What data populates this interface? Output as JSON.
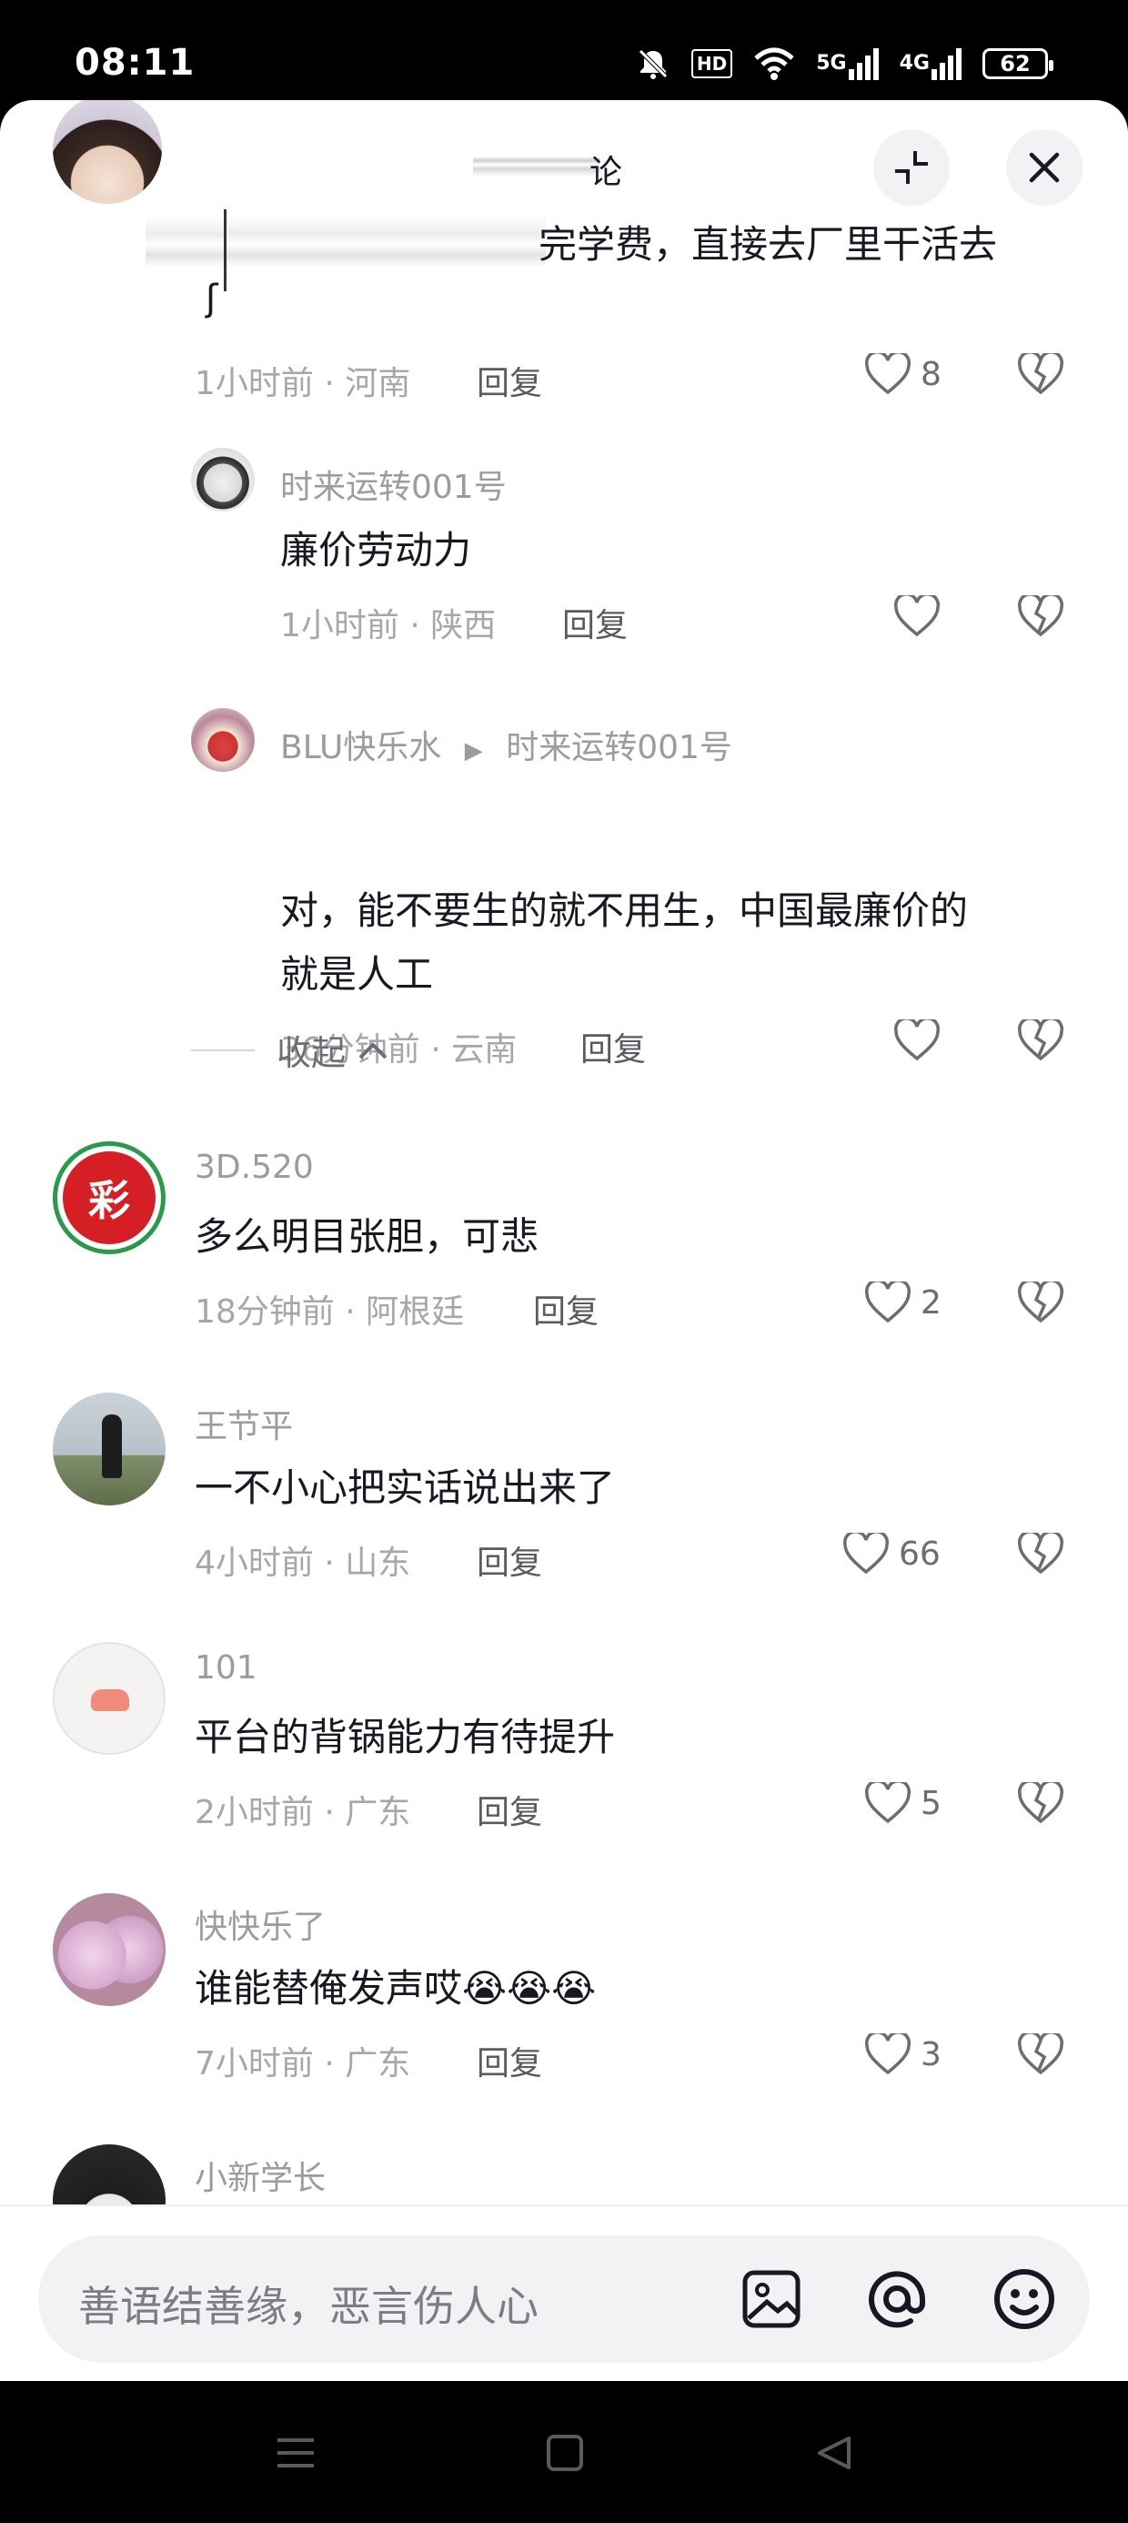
{
  "status_bar": {
    "time": "08:11",
    "battery": "62",
    "net1": "5G",
    "net2": "4G",
    "hd": "HD"
  },
  "header": {
    "title_fragment": "论",
    "icons": [
      "collapse-icon",
      "close-icon"
    ]
  },
  "first_comment": {
    "text_visible": "完学费，直接去厂里干活去",
    "time_location": "1小时前 · 河南",
    "reply_label": "回复",
    "likes": "8"
  },
  "replies": [
    {
      "name": "时来运转001号",
      "text": "廉价劳动力",
      "time_location": "1小时前 · 陕西",
      "reply_label": "回复",
      "likes": ""
    },
    {
      "name": "BLU快乐水",
      "reply_to": "时来运转001号",
      "text_line1": "对，能不要生的就不用生，中国最廉价的",
      "text_line2": "就是人工",
      "time_location": "36分钟前 · 云南",
      "reply_label": "回复",
      "likes": ""
    }
  ],
  "collapse_label": "收起",
  "comments": [
    {
      "name": "3D.520",
      "text": "多么明目张胆，可悲",
      "time_location": "18分钟前 · 阿根廷",
      "reply_label": "回复",
      "likes": "2"
    },
    {
      "name": "王节平",
      "text": "一不小心把实话说出来了",
      "time_location": "4小时前 · 山东",
      "reply_label": "回复",
      "likes": "66"
    },
    {
      "name": "101",
      "text": "平台的背锅能力有待提升",
      "time_location": "2小时前 · 广东",
      "reply_label": "回复",
      "likes": "5"
    },
    {
      "name": "快快乐了",
      "text": "谁能替俺发声哎😭😭😭",
      "time_location": "7小时前 · 广东",
      "reply_label": "回复",
      "likes": "3"
    },
    {
      "name": "小新学长"
    }
  ],
  "input_bar": {
    "placeholder": "善语结善缘，恶言伤人心",
    "icons": [
      "image-icon",
      "at-icon",
      "emoji-icon"
    ]
  },
  "colors": {
    "text_primary": "#161823",
    "text_secondary": "#9b9ba2",
    "background": "#ffffff",
    "pill": "#f2f2f4"
  }
}
